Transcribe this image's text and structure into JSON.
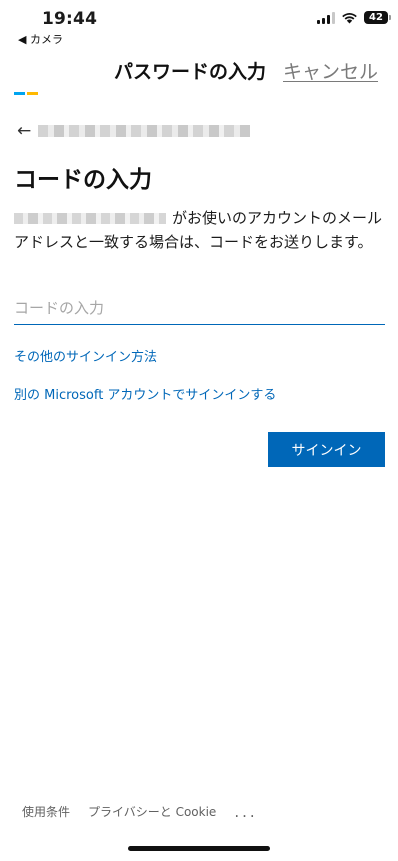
{
  "status_bar": {
    "time": "19:44",
    "back_app": "◀ カメラ",
    "battery": "42",
    "icons": [
      "signal-icon",
      "wifi-icon",
      "battery-icon"
    ]
  },
  "header": {
    "title": "パスワードの入力",
    "cancel_label": "キャンセル"
  },
  "logo": {
    "colors": [
      "#00a4ef",
      "#ffb900"
    ]
  },
  "back": {
    "icon": "back-arrow-icon"
  },
  "page": {
    "title": "コードの入力",
    "description": "がお使いのアカウントのメール アドレスと一致する場合は、コードをお送りします。"
  },
  "code_field": {
    "placeholder": "コードの入力",
    "value": ""
  },
  "links": {
    "other_signin": "その他のサインイン方法",
    "other_account": "別の Microsoft アカウントでサインインする"
  },
  "buttons": {
    "signin": "サインイン"
  },
  "footer": {
    "terms": "使用条件",
    "privacy": "プライバシーと Cookie",
    "more": "..."
  },
  "colors": {
    "accent": "#0067b8",
    "placeholder": "#a6a6a6",
    "cancel": "#7a7a7a"
  }
}
